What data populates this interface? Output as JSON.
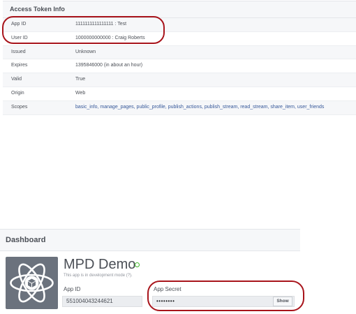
{
  "token_info": {
    "title": "Access Token Info",
    "rows": [
      {
        "key": "App ID",
        "value": "1111111111111111 : Test"
      },
      {
        "key": "User ID",
        "value": "1000000000000 : Craig Roberts"
      },
      {
        "key": "Issued",
        "value": "Unknown"
      },
      {
        "key": "Expires",
        "value": "1395846000 (in about an hour)"
      },
      {
        "key": "Valid",
        "value": "True"
      },
      {
        "key": "Origin",
        "value": "Web"
      },
      {
        "key": "Scopes",
        "value": "basic_info, manage_pages, public_profile, publish_actions, publish_stream, read_stream, share_item, user_friends"
      }
    ]
  },
  "dashboard": {
    "title": "Dashboard",
    "app_name": "MPD Demo",
    "dev_note": "This app is in development mode (?).",
    "app_id_label": "App ID",
    "app_id_value": "551004043244621",
    "app_secret_label": "App Secret",
    "app_secret_value": "••••••••",
    "show_label": "Show"
  },
  "colors": {
    "annotation": "#a8141b",
    "link": "#365899",
    "status": "#42b72a"
  },
  "icons": {
    "app_icon": "atom-cube-icon",
    "status": "status-circle-icon"
  }
}
